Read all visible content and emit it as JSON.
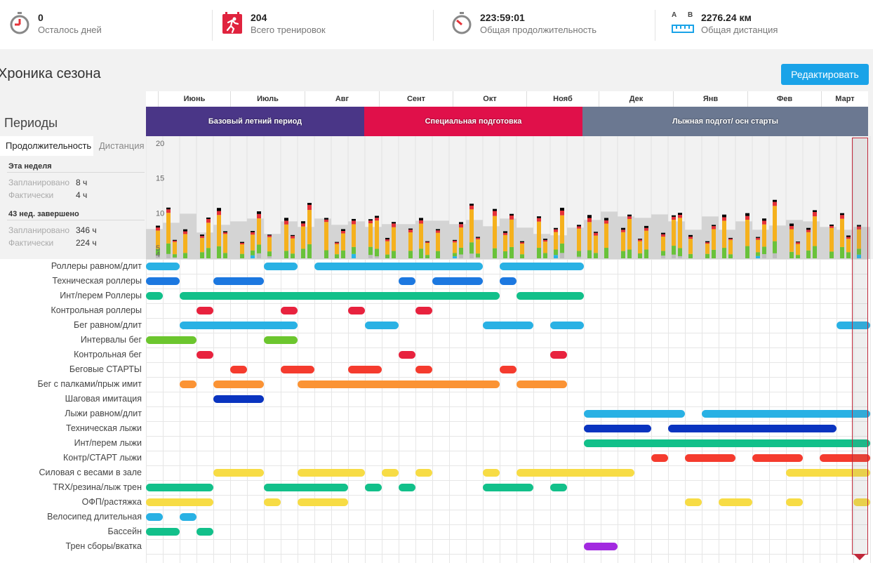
{
  "stats": [
    {
      "value": "0",
      "label": "Осталось дней",
      "icon": "stopwatch-icon"
    },
    {
      "value": "204",
      "label": "Всего тренировок",
      "icon": "calendar-runner-icon"
    },
    {
      "value": "223:59:01",
      "label": "Общая продолжительность",
      "icon": "stopwatch-icon"
    },
    {
      "value": "2276.24 км",
      "label": "Общая дистанция",
      "icon": "ruler-distance-icon",
      "icon_text_a": "A",
      "icon_text_b": "B"
    }
  ],
  "header": {
    "title": "Хроника сезона",
    "edit_label": "Редактировать"
  },
  "left_panel": {
    "periods_title": "Периоды",
    "tabs": [
      "Продолжительность",
      "Дистанция"
    ],
    "this_week": {
      "title": "Эта неделя",
      "planned_label": "Запланировано",
      "planned_value": "8 ч",
      "actual_label": "Фактически",
      "actual_value": "4 ч"
    },
    "completed": {
      "title": "43 нед. завершено",
      "planned_label": "Запланировано",
      "planned_value": "346 ч",
      "actual_label": "Фактически",
      "actual_value": "224 ч"
    }
  },
  "timeline": {
    "months": [
      "Июнь",
      "Июль",
      "Авг",
      "Сент",
      "Окт",
      "Нояб",
      "Дек",
      "Янв",
      "Фев",
      "Март"
    ],
    "periods": [
      {
        "label": "Базовый летний период",
        "color": "#4a3687",
        "start_week": 0,
        "end_week": 13
      },
      {
        "label": "Специальная подготовка",
        "color": "#e0104a",
        "start_week": 13,
        "end_week": 26
      },
      {
        "label": "Лыжная подгот/ осн старты",
        "color": "#6b7891",
        "start_week": 26,
        "end_week": 43
      }
    ],
    "current_week": 42
  },
  "chart_data": {
    "type": "bar",
    "x_unit": "weeks",
    "yticks": [
      4,
      5,
      10,
      15,
      20
    ],
    "ylim": [
      3.5,
      20
    ],
    "planned_color": "#d4d4d4",
    "segment_colors": [
      "#bdbdbd",
      "#29b6e8",
      "#69c23a",
      "#f5b11d",
      "#e53238"
    ],
    "planned": [
      7.7,
      8.6,
      9.9,
      7.2,
      8.3,
      8.8,
      9.2,
      7.0,
      8.8,
      8.0,
      9.2,
      8.3,
      8.8,
      8.0,
      8.4,
      8.4,
      8.9,
      8.9,
      8.4,
      9.0,
      8.1,
      9.2,
      7.9,
      7.0,
      6.8,
      7.9,
      9.0,
      10.2,
      9.5,
      9.3,
      9.8,
      8.8,
      7.6,
      9.5,
      7.6,
      8.8,
      7.6,
      8.2,
      9.0,
      8.8,
      8.0,
      7.6,
      8.0
    ],
    "actual": [
      [
        0,
        0.8,
        0.7,
        0.3,
        0,
        0,
        0,
        0,
        0,
        0,
        0,
        0
      ],
      [
        0.5,
        0,
        0,
        0,
        0,
        0,
        0,
        0,
        0,
        0,
        0,
        0
      ],
      [
        0.8,
        1.0,
        1.2,
        0.8,
        0.8,
        1.0,
        1.3,
        1.4,
        1.2,
        1.0,
        1.2,
        1.3
      ],
      [
        2.6,
        3.0,
        3.5,
        3.0,
        2.8,
        3.2,
        3.0,
        3.4,
        3.1,
        3.5,
        3.0,
        2.8
      ],
      [
        0.4,
        0.5,
        0.4,
        0.3,
        0.4,
        0.5,
        0.4,
        0.5,
        0.4,
        0.3,
        0.4,
        0.4
      ],
      [
        0.2,
        0.3,
        0.2,
        0.2,
        0.3,
        0.2,
        0.3,
        0.2,
        0.3,
        0.2,
        0.2,
        0.3
      ]
    ]
  },
  "gantt": {
    "rows": [
      {
        "label": "Роллеры равном/длит",
        "bars": [
          {
            "s": 0,
            "e": 2,
            "c": "#29b1e4"
          },
          {
            "s": 7,
            "e": 9,
            "c": "#29b1e4"
          },
          {
            "s": 10,
            "e": 20,
            "c": "#29b1e4"
          },
          {
            "s": 21,
            "e": 26,
            "c": "#29b1e4"
          }
        ]
      },
      {
        "label": "Техническая роллеры",
        "bars": [
          {
            "s": 0,
            "e": 2,
            "c": "#1c78e0"
          },
          {
            "s": 4,
            "e": 7,
            "c": "#1c78e0"
          },
          {
            "s": 15,
            "e": 16,
            "c": "#1c78e0"
          },
          {
            "s": 17,
            "e": 20,
            "c": "#1c78e0"
          },
          {
            "s": 21,
            "e": 22,
            "c": "#1c78e0"
          }
        ]
      },
      {
        "label": "Инт/перем Роллеры",
        "bars": [
          {
            "s": 0,
            "e": 1,
            "c": "#12c08a"
          },
          {
            "s": 2,
            "e": 21,
            "c": "#12c08a"
          },
          {
            "s": 22,
            "e": 26,
            "c": "#12c08a"
          }
        ]
      },
      {
        "label": "Контрольная роллеры",
        "bars": [
          {
            "s": 3,
            "e": 4,
            "c": "#e8223e"
          },
          {
            "s": 8,
            "e": 9,
            "c": "#e8223e"
          },
          {
            "s": 12,
            "e": 13,
            "c": "#e8223e"
          },
          {
            "s": 16,
            "e": 17,
            "c": "#e8223e"
          }
        ]
      },
      {
        "label": "Бег равном/длит",
        "bars": [
          {
            "s": 2,
            "e": 9,
            "c": "#29b1e4"
          },
          {
            "s": 13,
            "e": 15,
            "c": "#29b1e4"
          },
          {
            "s": 20,
            "e": 23,
            "c": "#29b1e4"
          },
          {
            "s": 24,
            "e": 26,
            "c": "#29b1e4"
          },
          {
            "s": 41,
            "e": 43,
            "c": "#29b1e4"
          }
        ]
      },
      {
        "label": "Интервалы бег",
        "bars": [
          {
            "s": 0,
            "e": 3,
            "c": "#6cc62e"
          },
          {
            "s": 7,
            "e": 9,
            "c": "#6cc62e"
          }
        ]
      },
      {
        "label": "Контрольная бег",
        "bars": [
          {
            "s": 3,
            "e": 4,
            "c": "#e8223e"
          },
          {
            "s": 15,
            "e": 16,
            "c": "#e8223e"
          },
          {
            "s": 24,
            "e": 25,
            "c": "#e8223e"
          }
        ]
      },
      {
        "label": "Беговые СТАРТЫ",
        "bars": [
          {
            "s": 5,
            "e": 6,
            "c": "#f53b2e"
          },
          {
            "s": 8,
            "e": 10,
            "c": "#f53b2e"
          },
          {
            "s": 12,
            "e": 14,
            "c": "#f53b2e"
          },
          {
            "s": 16,
            "e": 17,
            "c": "#f53b2e"
          },
          {
            "s": 21,
            "e": 22,
            "c": "#f53b2e"
          }
        ]
      },
      {
        "label": "Бег с палками/прыж имит",
        "bars": [
          {
            "s": 2,
            "e": 3,
            "c": "#fb9334"
          },
          {
            "s": 4,
            "e": 7,
            "c": "#fb9334"
          },
          {
            "s": 9,
            "e": 21,
            "c": "#fb9334"
          },
          {
            "s": 22,
            "e": 25,
            "c": "#fb9334"
          }
        ]
      },
      {
        "label": "Шаговая имитация",
        "bars": [
          {
            "s": 4,
            "e": 7,
            "c": "#0a34c0"
          }
        ]
      },
      {
        "label": "Лыжи равном/длит",
        "bars": [
          {
            "s": 26,
            "e": 32,
            "c": "#29b1e4"
          },
          {
            "s": 33,
            "e": 43,
            "c": "#29b1e4"
          }
        ]
      },
      {
        "label": "Техническая лыжи",
        "bars": [
          {
            "s": 26,
            "e": 30,
            "c": "#0a34c0"
          },
          {
            "s": 31,
            "e": 41,
            "c": "#0a34c0"
          }
        ]
      },
      {
        "label": "Инт/перем лыжи",
        "bars": [
          {
            "s": 26,
            "e": 43,
            "c": "#12c08a"
          }
        ]
      },
      {
        "label": "Контр/СТАРТ лыжи",
        "bars": [
          {
            "s": 30,
            "e": 31,
            "c": "#f53b2e"
          },
          {
            "s": 32,
            "e": 35,
            "c": "#f53b2e"
          },
          {
            "s": 36,
            "e": 39,
            "c": "#f53b2e"
          },
          {
            "s": 40,
            "e": 43,
            "c": "#f53b2e"
          }
        ]
      },
      {
        "label": "Силовая с весами в зале",
        "bars": [
          {
            "s": 4,
            "e": 7,
            "c": "#f7dc45"
          },
          {
            "s": 9,
            "e": 13,
            "c": "#f7dc45"
          },
          {
            "s": 14,
            "e": 15,
            "c": "#f7dc45"
          },
          {
            "s": 16,
            "e": 17,
            "c": "#f7dc45"
          },
          {
            "s": 20,
            "e": 21,
            "c": "#f7dc45"
          },
          {
            "s": 22,
            "e": 29,
            "c": "#f7dc45"
          },
          {
            "s": 38,
            "e": 43,
            "c": "#f7dc45"
          }
        ]
      },
      {
        "label": "TRX/резина/лыж трен",
        "bars": [
          {
            "s": 0,
            "e": 4,
            "c": "#12c08a"
          },
          {
            "s": 7,
            "e": 12,
            "c": "#12c08a"
          },
          {
            "s": 13,
            "e": 14,
            "c": "#12c08a"
          },
          {
            "s": 15,
            "e": 16,
            "c": "#12c08a"
          },
          {
            "s": 20,
            "e": 23,
            "c": "#12c08a"
          },
          {
            "s": 24,
            "e": 25,
            "c": "#12c08a"
          }
        ]
      },
      {
        "label": "ОФП/растяжка",
        "bars": [
          {
            "s": 0,
            "e": 4,
            "c": "#f7dc45"
          },
          {
            "s": 7,
            "e": 8,
            "c": "#f7dc45"
          },
          {
            "s": 9,
            "e": 12,
            "c": "#f7dc45"
          },
          {
            "s": 32,
            "e": 33,
            "c": "#f7dc45"
          },
          {
            "s": 34,
            "e": 36,
            "c": "#f7dc45"
          },
          {
            "s": 38,
            "e": 39,
            "c": "#f7dc45"
          },
          {
            "s": 42,
            "e": 43,
            "c": "#f7dc45"
          }
        ]
      },
      {
        "label": "Велосипед длительная",
        "bars": [
          {
            "s": 0,
            "e": 1,
            "c": "#29b1e4"
          },
          {
            "s": 2,
            "e": 3,
            "c": "#29b1e4"
          }
        ]
      },
      {
        "label": "Бассейн",
        "bars": [
          {
            "s": 0,
            "e": 2,
            "c": "#12c08a"
          },
          {
            "s": 3,
            "e": 4,
            "c": "#12c08a"
          }
        ]
      },
      {
        "label": "Трен сборы/вкатка",
        "bars": [
          {
            "s": 26,
            "e": 28,
            "c": "#a229e0"
          }
        ]
      }
    ]
  }
}
